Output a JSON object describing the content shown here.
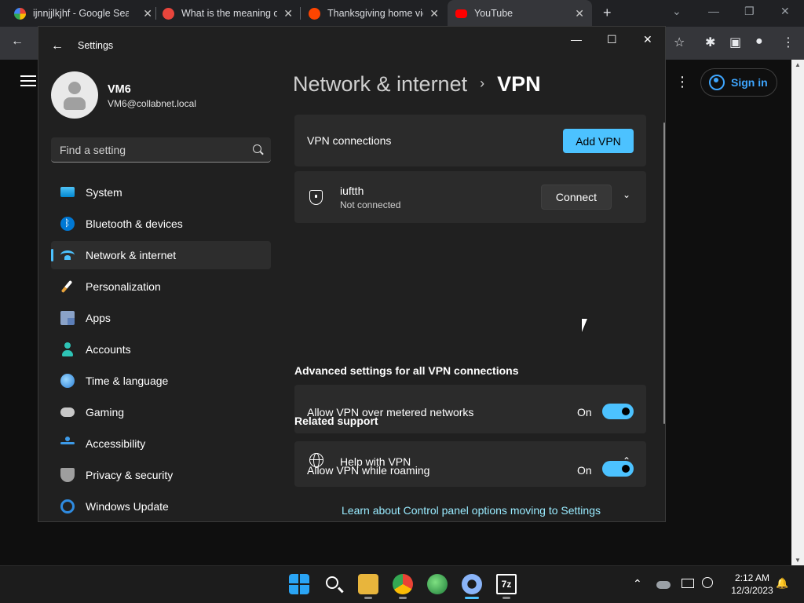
{
  "browser": {
    "tabs": [
      {
        "title": "ijnnjjlkjhf - Google Search",
        "favicon_color": "#ffffff"
      },
      {
        "title": "What is the meaning of",
        "favicon_color": "#e8453c"
      },
      {
        "title": "Thanksgiving home vic",
        "favicon_color": "#ff4500"
      },
      {
        "title": "YouTube",
        "favicon_color": "#ff0000"
      }
    ],
    "close_glyph": "✕",
    "new_tab_glyph": "+",
    "window_controls": [
      "⌄",
      "—",
      "❐",
      "✕"
    ],
    "toolbar_icons": [
      "←",
      "☆",
      "✱",
      "▣",
      "●",
      "⋮"
    ]
  },
  "youtube": {
    "more_glyph": "⋮",
    "sign_in_label": "Sign in",
    "accent": "#3ea6ff"
  },
  "settings": {
    "window_title": "Settings",
    "back_glyph": "←",
    "window_controls": [
      "—",
      "☐",
      "✕"
    ],
    "user": {
      "name": "VM6",
      "email": "VM6@collabnet.local"
    },
    "search": {
      "placeholder": "Find a setting"
    },
    "nav": [
      {
        "label": "System",
        "icon": "system-icon",
        "cls": "ic-system"
      },
      {
        "label": "Bluetooth & devices",
        "icon": "bluetooth-icon",
        "cls": "ic-bt"
      },
      {
        "label": "Network & internet",
        "icon": "wifi-icon",
        "cls": "ic-net",
        "selected": true
      },
      {
        "label": "Personalization",
        "icon": "brush-icon",
        "cls": "ic-pers"
      },
      {
        "label": "Apps",
        "icon": "apps-icon",
        "cls": "ic-apps"
      },
      {
        "label": "Accounts",
        "icon": "person-icon",
        "cls": "ic-acc"
      },
      {
        "label": "Time & language",
        "icon": "globe-clock-icon",
        "cls": "ic-time"
      },
      {
        "label": "Gaming",
        "icon": "gamepad-icon",
        "cls": "ic-game"
      },
      {
        "label": "Accessibility",
        "icon": "accessibility-icon",
        "cls": "ic-a11y"
      },
      {
        "label": "Privacy & security",
        "icon": "shield-icon",
        "cls": "ic-priv"
      },
      {
        "label": "Windows Update",
        "icon": "update-icon",
        "cls": "ic-upd"
      }
    ],
    "breadcrumb": {
      "parent": "Network & internet",
      "separator": "›",
      "current": "VPN"
    },
    "vpn_connections_label": "VPN connections",
    "add_vpn_label": "Add VPN",
    "connection": {
      "name": "iuftth",
      "status": "Not connected",
      "connect_label": "Connect",
      "expand_glyph": "⌄"
    },
    "advanced_title": "Advanced settings for all VPN connections",
    "toggles": [
      {
        "label": "Allow VPN over metered networks",
        "state": "On"
      },
      {
        "label": "Allow VPN while roaming",
        "state": "On"
      }
    ],
    "related_title": "Related support",
    "help_label": "Help with VPN",
    "help_glyph": "⌃",
    "control_panel_link": "Learn about Control panel options moving to Settings",
    "accent": "#4cc2ff"
  },
  "taskbar": {
    "clock_time": "2:12 AM",
    "clock_date": "12/3/2023",
    "tray_chevron": "⌃",
    "seven_zip_label": "7z",
    "notification_glyph": "🔔"
  }
}
